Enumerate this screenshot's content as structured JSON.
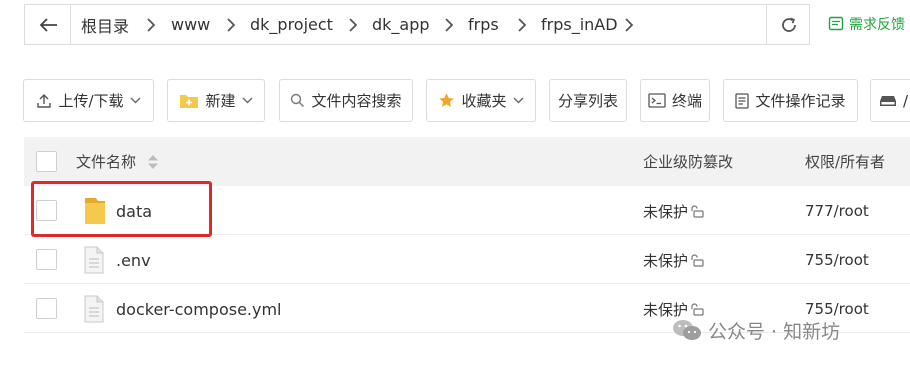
{
  "breadcrumbs": [
    "根目录",
    "www",
    "dk_project",
    "dk_app",
    "frps",
    "frps_inAD"
  ],
  "feedback_label": "需求反馈",
  "toolbar": {
    "upload_download": "上传/下载",
    "new": "新建",
    "content_search": "文件内容搜索",
    "favorites": "收藏夹",
    "share_list": "分享列表",
    "terminal": "终端",
    "file_op_log": "文件操作记录",
    "cut_off_label": "/"
  },
  "table": {
    "headers": {
      "name": "文件名称",
      "protect": "企业级防篡改",
      "perm_owner": "权限/所有者"
    },
    "rows": [
      {
        "name": "data",
        "type": "folder",
        "protect": "未保护",
        "perm": "777/root"
      },
      {
        "name": ".env",
        "type": "file",
        "protect": "未保护",
        "perm": "755/root"
      },
      {
        "name": "docker-compose.yml",
        "type": "file",
        "protect": "未保护",
        "perm": "755/root"
      }
    ]
  },
  "watermark": "公众号 · 知新坊",
  "colors": {
    "accent_green": "#20a53a",
    "highlight_red": "#e02a2a",
    "folder_yellow": "#f6c84b"
  },
  "icons": {
    "back": "arrow-left-icon",
    "refresh": "refresh-icon",
    "feedback": "feedback-icon",
    "upload": "upload-icon",
    "new_folder": "new-folder-icon",
    "search": "search-icon",
    "star": "star-icon",
    "terminal": "terminal-icon",
    "log": "log-icon",
    "disk": "disk-icon",
    "sort": "sort-icon",
    "lock": "unlock-icon",
    "wechat": "wechat-icon"
  }
}
